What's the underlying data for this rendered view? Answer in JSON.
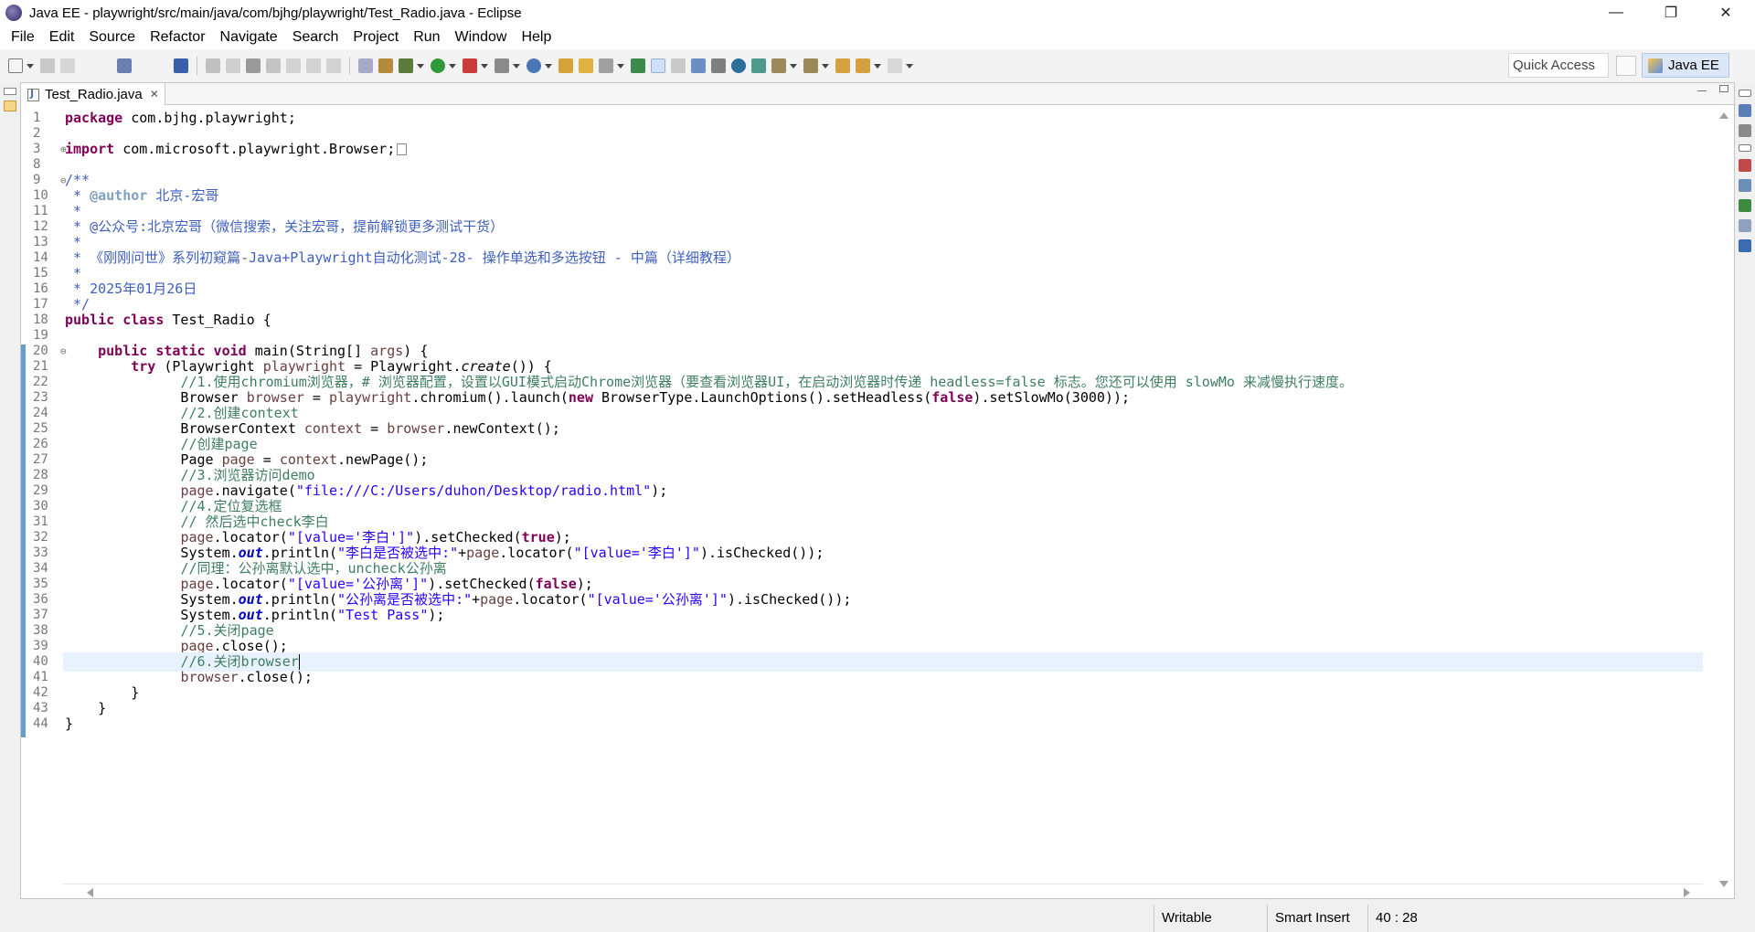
{
  "window": {
    "title": "Java EE - playwright/src/main/java/com/bjhg/playwright/Test_Radio.java - Eclipse",
    "minimize": "—",
    "restore": "❐",
    "close": "✕"
  },
  "menus": [
    "File",
    "Edit",
    "Source",
    "Refactor",
    "Navigate",
    "Search",
    "Project",
    "Run",
    "Window",
    "Help"
  ],
  "toolbar": {
    "quick_access": "Quick Access",
    "perspective": "Java EE"
  },
  "editor": {
    "tab_label": "Test_Radio.java",
    "tab_close": "✕"
  },
  "code": {
    "line_numbers": [
      "1",
      "2",
      "3",
      "8",
      "9",
      "10",
      "11",
      "12",
      "13",
      "14",
      "15",
      "16",
      "17",
      "18",
      "19",
      "20",
      "21",
      "22",
      "23",
      "24",
      "25",
      "26",
      "27",
      "28",
      "29",
      "30",
      "31",
      "32",
      "33",
      "34",
      "35",
      "36",
      "37",
      "38",
      "39",
      "40",
      "41",
      "42",
      "43",
      "44"
    ],
    "package": "com.bjhg.playwright;",
    "import": "com.microsoft.playwright.Browser;",
    "author": "北京-宏哥",
    "wechat": "@公众号:北京宏哥（微信搜索，关注宏哥，提前解锁更多测试干货）",
    "series": "《刚刚问世》系列初窥篇-Java+Playwright自动化测试-28- 操作单选和多选按钮 - 中篇（详细教程）",
    "date": "2025年01月26日",
    "class_name": "Test_Radio",
    "comment_1": "//1.使用chromium浏览器，# 浏览器配置，设置以GUI模式启动Chrome浏览器（要查看浏览器UI，在启动浏览器时传递 headless=false 标志。您还可以使用 slowMo 来减慢执行速度。",
    "comment_2": "//2.创建context",
    "comment_create_page": "//创建page",
    "comment_3": "//3.浏览器访问demo",
    "url": "\"file:///C:/Users/duhon/Desktop/radio.html\"",
    "comment_4": "//4.定位复选框",
    "comment_check": "// 然后选中check李白",
    "locator_libai": "\"[value='李白']\"",
    "print_libai": "\"李白是否被选中:\"",
    "comment_uncheck": "//同理：公孙离默认选中，uncheck公孙离",
    "locator_gongsun": "\"[value='公孙离']\"",
    "print_gongsun": "\"公孙离是否被选中:\"",
    "print_pass": "\"Test Pass\"",
    "comment_5": "//5.关闭page",
    "comment_6": "//6.关闭browser",
    "slowmo": "3000"
  },
  "status": {
    "writable": "Writable",
    "insert_mode": "Smart Insert",
    "position": "40 : 28"
  },
  "colors": {
    "keyword": "#7f0055",
    "comment": "#3f7f5f",
    "javadoc": "#3f5fbf",
    "string": "#2a00ff",
    "current_line": "#e8f2fe",
    "ruler_band": "#6b9bd1"
  }
}
